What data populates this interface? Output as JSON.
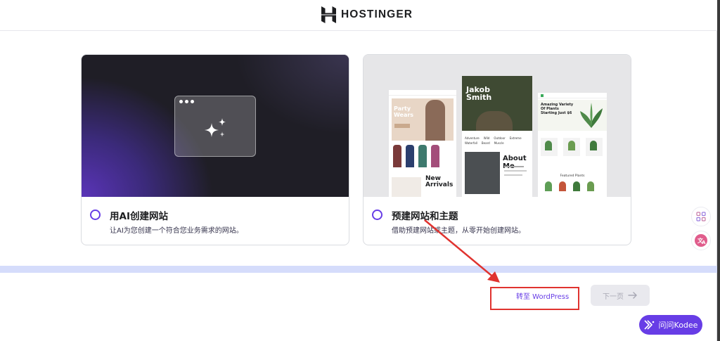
{
  "header": {
    "brand": "HOSTINGER",
    "logo_icon": "hostinger-logo-icon"
  },
  "options": [
    {
      "title": "用AI创建网站",
      "description": "让AI为您创建一个符合您业务需求的网站。",
      "icon": "sparkles-icon"
    },
    {
      "title": "预建网站和主题",
      "description": "借助预建网站或主题，从零开始创建网站。"
    }
  ],
  "template_previews": {
    "fashion": {
      "headline": "Party Wears",
      "section": "New Arrivals"
    },
    "portfolio": {
      "name": "Jakob Smith",
      "menu": [
        "Adventure",
        "Wild",
        "Outdoor",
        "Extreme",
        "Waterfall",
        "Beard",
        "Muscle"
      ],
      "section": "About Me"
    },
    "plants": {
      "headline": "Amazing Variety Of Plants Starting Just $6",
      "section": "Featured Plants"
    }
  },
  "footer": {
    "wordpress_link": "转至 WordPress",
    "next_button": "下一页",
    "next_icon": "arrow-right-icon"
  },
  "assistant": {
    "label": "问问Kodee",
    "icon": "kodee-icon"
  },
  "side_tools": [
    {
      "icon": "apps-grid-icon"
    },
    {
      "icon": "translate-icon"
    }
  ],
  "colors": {
    "accent": "#673de6",
    "annotation": "#e0332f",
    "band": "#d5dcfb"
  }
}
